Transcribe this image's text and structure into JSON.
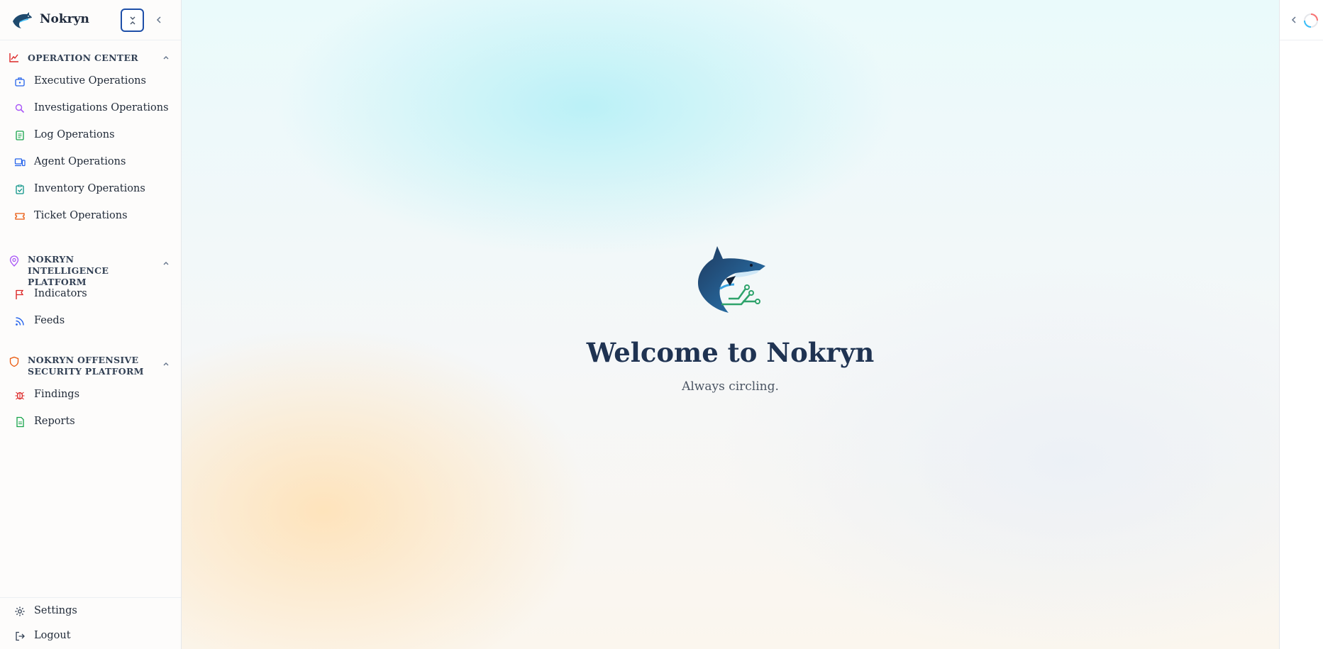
{
  "app": {
    "name": "Nokryn"
  },
  "sidebar": {
    "sections": [
      {
        "title": "OPERATION CENTER",
        "icon": "chart-line-icon",
        "items": [
          {
            "label": "Executive Operations",
            "icon": "briefcase-icon"
          },
          {
            "label": "Investigations Operations",
            "icon": "search-icon"
          },
          {
            "label": "Log Operations",
            "icon": "document-list-icon"
          },
          {
            "label": "Agent Operations",
            "icon": "devices-icon"
          },
          {
            "label": "Inventory Operations",
            "icon": "clipboard-check-icon"
          },
          {
            "label": "Ticket Operations",
            "icon": "ticket-icon"
          }
        ]
      },
      {
        "title": "NOKRYN INTELLIGENCE PLATFORM",
        "icon": "radar-pin-icon",
        "items": [
          {
            "label": "Indicators",
            "icon": "flag-icon"
          },
          {
            "label": "Feeds",
            "icon": "rss-icon"
          }
        ]
      },
      {
        "title": "NOKRYN OFFENSIVE SECURITY PLATFORM",
        "icon": "shield-icon",
        "items": [
          {
            "label": "Findings",
            "icon": "bug-icon"
          },
          {
            "label": "Reports",
            "icon": "file-text-icon"
          }
        ]
      }
    ],
    "bottom": [
      {
        "label": "Settings",
        "icon": "gear-icon"
      },
      {
        "label": "Logout",
        "icon": "logout-icon"
      }
    ]
  },
  "main": {
    "welcome_title": "Welcome to Nokryn",
    "tagline": "Always circling."
  },
  "colors": {
    "accent": "#1e4fa8",
    "section_red": "#dc2626",
    "section_purple": "#a855f7",
    "section_orange": "#ea580c"
  }
}
